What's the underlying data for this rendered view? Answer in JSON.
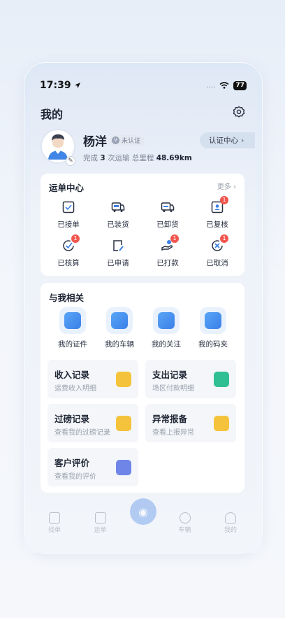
{
  "status": {
    "time": "17:39",
    "signal": "....",
    "battery": "77"
  },
  "header": {
    "title": "我的"
  },
  "profile": {
    "name": "杨洋",
    "verify_status": "未认证",
    "stats_prefix": "完成",
    "trip_count": "3",
    "stats_middle": "次运输 总里程",
    "mileage": "48.69km",
    "cert_center": "认证中心"
  },
  "orders": {
    "title": "运单中心",
    "more": "更多",
    "items": [
      {
        "label": "已接单",
        "icon": "order-accepted-icon",
        "badge": ""
      },
      {
        "label": "已装货",
        "icon": "loaded-truck-icon",
        "badge": ""
      },
      {
        "label": "已卸货",
        "icon": "unloaded-truck-icon",
        "badge": ""
      },
      {
        "label": "已复核",
        "icon": "review-icon",
        "badge": "1"
      },
      {
        "label": "已核算",
        "icon": "checked-icon",
        "badge": "1"
      },
      {
        "label": "已申请",
        "icon": "apply-icon",
        "badge": ""
      },
      {
        "label": "已打款",
        "icon": "payment-icon",
        "badge": "1"
      },
      {
        "label": "已取消",
        "icon": "cancel-icon",
        "badge": "1"
      }
    ]
  },
  "related": {
    "title": "与我相关",
    "items": [
      {
        "label": "我的证件",
        "icon": "id-card-icon"
      },
      {
        "label": "我的车辆",
        "icon": "vehicle-icon"
      },
      {
        "label": "我的关注",
        "icon": "heart-icon"
      },
      {
        "label": "我的码夹",
        "icon": "code-folder-icon"
      }
    ],
    "tiles": [
      {
        "title": "收入记录",
        "sub": "运费收入明细",
        "color": "#f5c33b"
      },
      {
        "title": "支出记录",
        "sub": "场区付款明细",
        "color": "#2fbf93"
      },
      {
        "title": "过磅记录",
        "sub": "查看我的过磅记录",
        "color": "#f5c33b"
      },
      {
        "title": "异常报备",
        "sub": "查看上报异常",
        "color": "#f5c33b"
      },
      {
        "title": "客户评价",
        "sub": "查看我的评价",
        "color": "#6f86e8"
      }
    ]
  },
  "tabbar": {
    "items": [
      "找单",
      "运单",
      "",
      "车辆",
      "我的"
    ]
  }
}
